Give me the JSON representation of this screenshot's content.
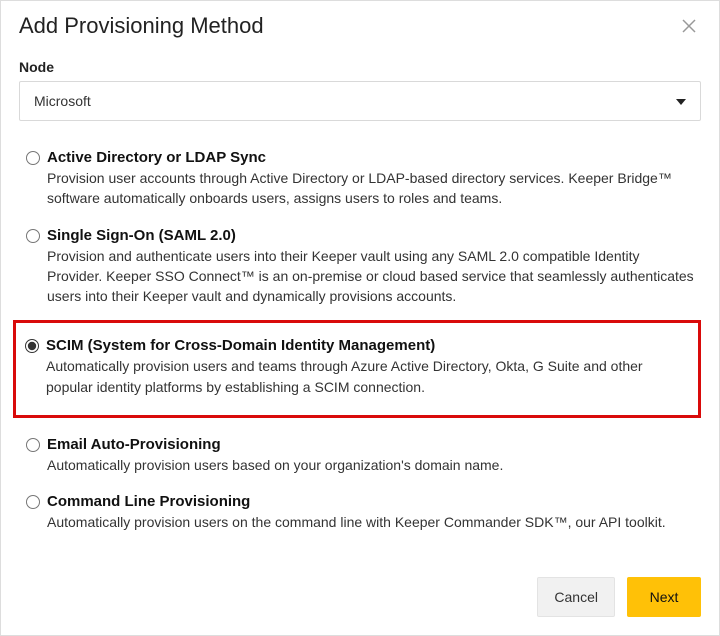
{
  "dialog": {
    "title": "Add Provisioning Method",
    "close_aria": "Close"
  },
  "node": {
    "label": "Node",
    "selected": "Microsoft"
  },
  "options": [
    {
      "title": "Active Directory or LDAP Sync",
      "desc": "Provision user accounts through Active Directory or LDAP-based directory services. Keeper Bridge™ software automatically onboards users, assigns users to roles and teams.",
      "selected": false
    },
    {
      "title": "Single Sign-On (SAML 2.0)",
      "desc": "Provision and authenticate users into their Keeper vault using any SAML 2.0 compatible Identity Provider. Keeper SSO Connect™ is an on-premise or cloud based service that seamlessly authenticates users into their Keeper vault and dynamically provisions accounts.",
      "selected": false
    },
    {
      "title": "SCIM (System for Cross-Domain Identity Management)",
      "desc": "Automatically provision users and teams through Azure Active Directory, Okta, G Suite and other popular identity platforms by establishing a SCIM connection.",
      "selected": true
    },
    {
      "title": "Email Auto-Provisioning",
      "desc": "Automatically provision users based on your organization's domain name.",
      "selected": false
    },
    {
      "title": "Command Line Provisioning",
      "desc": "Automatically provision users on the command line with Keeper Commander SDK™, our API toolkit.",
      "selected": false
    }
  ],
  "footer": {
    "cancel": "Cancel",
    "next": "Next"
  },
  "highlighted_index": 2
}
